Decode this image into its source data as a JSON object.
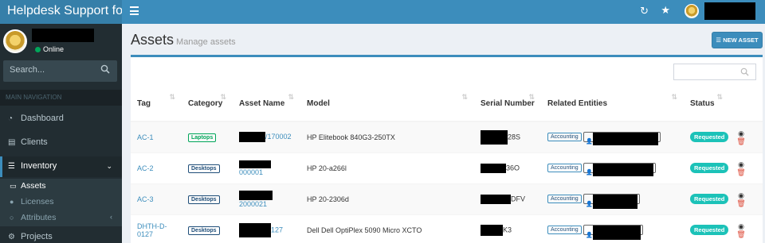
{
  "app": {
    "title": "Helpdesk Support for"
  },
  "sidebar": {
    "status": "Online",
    "search_placeholder": "Search...",
    "nav_header": "MAIN NAVIGATION",
    "items": [
      {
        "label": "Dashboard",
        "icon": "dashboard-icon"
      },
      {
        "label": "Clients",
        "icon": "clients-icon"
      },
      {
        "label": "Inventory",
        "icon": "inventory-icon"
      },
      {
        "label": "Assets",
        "icon": "desktop-icon"
      },
      {
        "label": "Licenses",
        "icon": "circle-icon"
      },
      {
        "label": "Attributes",
        "icon": "circle-outline-icon"
      },
      {
        "label": "Projects",
        "icon": "projects-icon"
      }
    ]
  },
  "page": {
    "title": "Assets",
    "subtitle": "Manage assets",
    "new_button": "NEW ASSET"
  },
  "table": {
    "columns": [
      "Tag",
      "Category",
      "Asset Name",
      "Model",
      "Serial Number",
      "Related Entities",
      "Status"
    ],
    "rows": [
      {
        "tag": "AC-1",
        "category": "Laptops",
        "asset_name": "/170002",
        "model": "HP Elitebook 840G3-250TX",
        "serial": "28S",
        "entity": "Accounting",
        "status": "Requested"
      },
      {
        "tag": "AC-2",
        "category": "Desktops",
        "asset_name": "000001",
        "model": "HP 20-a266l",
        "serial": "36O",
        "entity": "Accounting",
        "status": "Requested"
      },
      {
        "tag": "AC-3",
        "category": "Desktops",
        "asset_name": "2000021",
        "model": "HP 20-2306d",
        "serial": "DFV",
        "entity": "Accounting",
        "status": "Requested"
      },
      {
        "tag": "DHTH-D-0127",
        "category": "Desktops",
        "asset_name": "127",
        "model": "Dell Dell OptiPlex 5090 Micro XCTO",
        "serial": "K3",
        "entity": "Accounting",
        "status": "Requested"
      }
    ]
  }
}
